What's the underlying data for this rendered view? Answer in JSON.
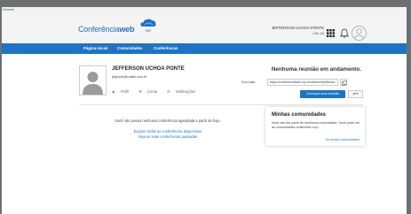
{
  "browser": {
    "url": "te/home"
  },
  "header": {
    "logo_light": "Conferência",
    "logo_bold": "web",
    "rnp_label": "RNP",
    "user_name": "JEFFERSON UCHOA PONTE",
    "user_org": "UNILAB"
  },
  "nav": {
    "items": [
      {
        "label": "Página inicial"
      },
      {
        "label": "Comunidades"
      },
      {
        "label": "Conferências"
      }
    ]
  },
  "profile": {
    "name": "JEFFERSON UCHOA PONTE",
    "email": "jefponte@unilab.edu.br",
    "links": [
      {
        "icon": "user-icon",
        "label": "Perfil"
      },
      {
        "icon": "wrench-icon",
        "label": "Conta"
      },
      {
        "icon": "envelope-icon",
        "label": "Notificações"
      }
    ]
  },
  "meeting": {
    "title": "Nenhuma reunião em andamento.",
    "room_label": "Sua sala:",
    "room_url": "https://conferenciaweb.rnp.br/webconf/jefferson",
    "start_button": "Começar uma reunião",
    "lang_button": "pt"
  },
  "main": {
    "empty_message": "Você não possui nenhuma conferência agendada a partir de hoje.",
    "explore_link": "Explore todas as conferências disponíveis",
    "past_link": "Veja as suas conferências passadas"
  },
  "communities": {
    "title": "Minhas comunidades",
    "text": "Você não faz parte de nenhuma comunidade. Você pode ver as comunidades existentes",
    "text_link": "aqui",
    "view_all": "Ver todas comunidades"
  },
  "colors": {
    "brand": "#1d74c6",
    "background": "#6d6f73"
  }
}
